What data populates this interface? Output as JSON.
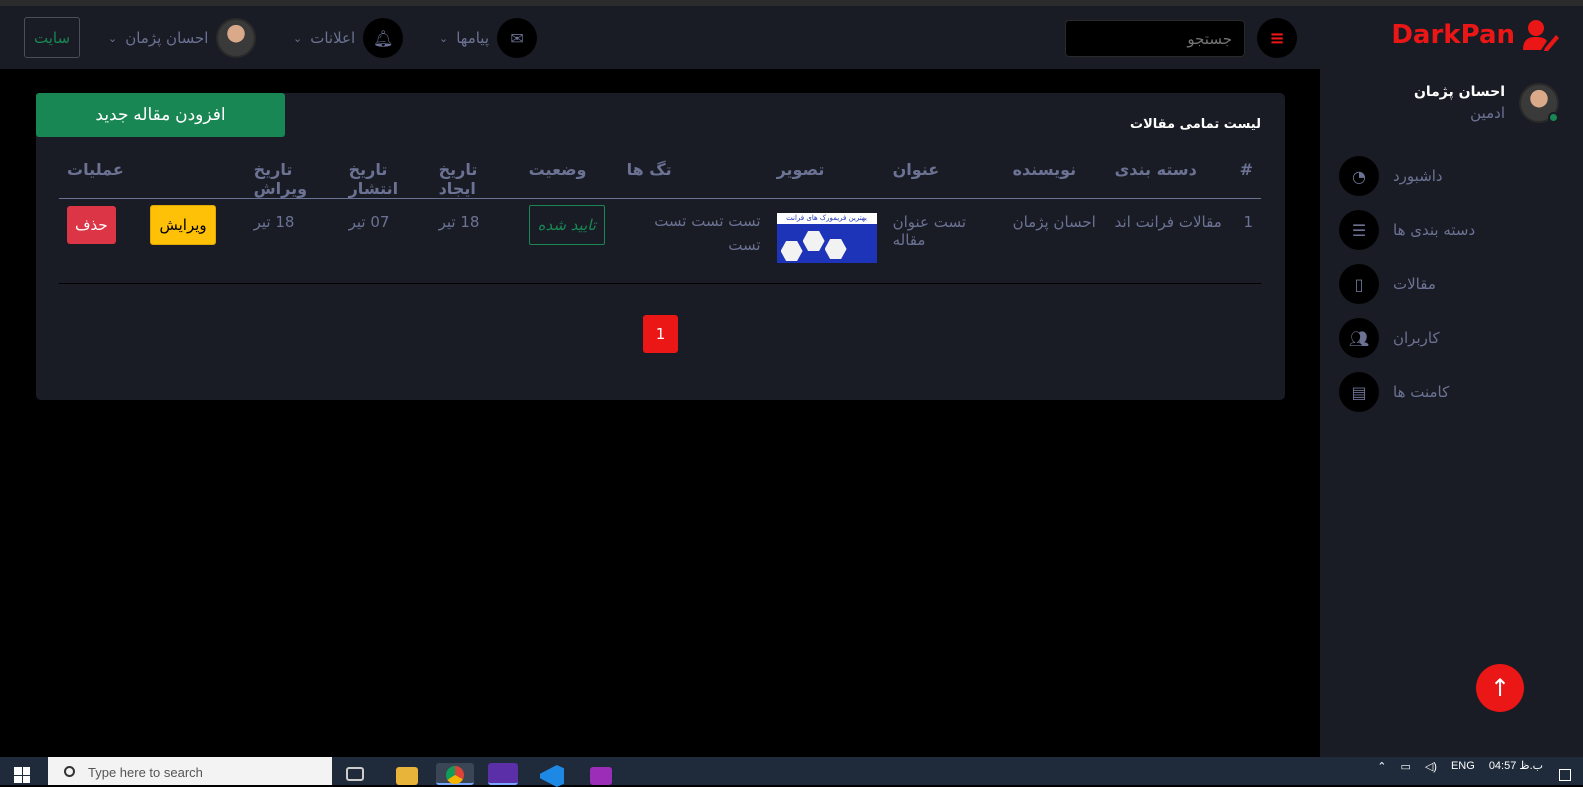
{
  "brand": {
    "name": "DarkPan",
    "accent": "#eb1616"
  },
  "header": {
    "search_placeholder": "جستجو",
    "messages_label": "پیامها",
    "notifications_label": "اعلانات",
    "user_name": "احسان پژمان",
    "site_button": "سایت"
  },
  "sidebar": {
    "profile": {
      "name": "احسان پژمان",
      "role": "ادمین"
    },
    "items": [
      {
        "label": "داشبورد",
        "icon": "dashboard-icon"
      },
      {
        "label": "دسته بندی ها",
        "icon": "list-icon"
      },
      {
        "label": "مقالات",
        "icon": "mobile-icon"
      },
      {
        "label": "کاربران",
        "icon": "users-icon"
      },
      {
        "label": "کامنت ها",
        "icon": "comment-icon"
      }
    ]
  },
  "main": {
    "add_button": "افزودن مقاله جدید",
    "card_title": "لیست تمامی مقالات",
    "table": {
      "headers": [
        "#",
        "دسته بندی",
        "نویسنده",
        "عنوان",
        "تصویر",
        "تگ ها",
        "وضعیت",
        "تاریخ ایجاد",
        "تاریخ انتشار",
        "تاریخ ویراش",
        "عملیات"
      ],
      "rows": [
        {
          "num": "1",
          "category": "مقالات فرانت اند",
          "author": "احسان پژمان",
          "title": "تست عنوان مقاله",
          "image_caption": "بهترین فریمورک های فرانت",
          "tags": "تست تست تست تست",
          "status": "تایید شده",
          "created": "18 تیر",
          "published": "07 تیر",
          "edited": "18 تیر",
          "edit_label": "ویرایش",
          "delete_label": "حذف"
        }
      ]
    },
    "pagination": {
      "current": "1"
    }
  },
  "taskbar": {
    "search_placeholder": "Type here to search",
    "lang": "ENG",
    "time": "04:57",
    "ampm": "ب.ظ"
  }
}
